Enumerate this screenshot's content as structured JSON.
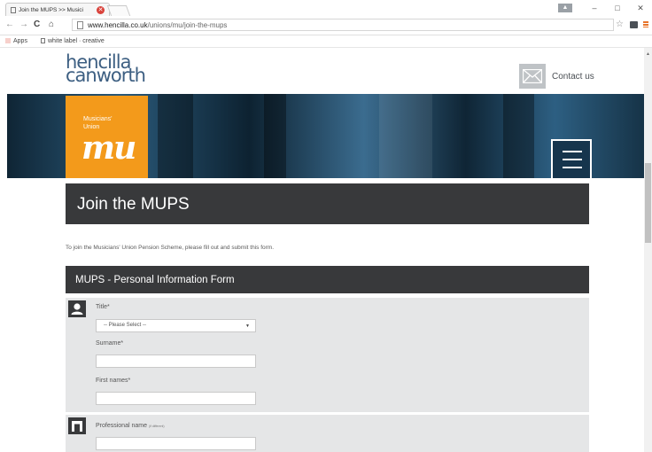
{
  "browser": {
    "tab_title": "Join the MUPS >> Musici",
    "tab_close": "✕",
    "window_user": "▲",
    "minimize": "–",
    "maximize": "□",
    "close": "✕",
    "url_host": "www.hencilla.co.uk",
    "url_path": "/unions/mu/join-the-mups",
    "bookmarks": {
      "apps": "Apps",
      "white_label": "white label · creative"
    }
  },
  "header": {
    "logo_line1": "hencilla",
    "logo_line2": "canworth",
    "contact_label": "Contact us"
  },
  "hero": {
    "badge_line1": "Musicians'",
    "badge_line2": "Union",
    "badge_mark": "mu"
  },
  "page": {
    "title": "Join the MUPS",
    "intro": "To join the Musicians' Union Pension Scheme, please fill out and submit this form.",
    "form_title": "MUPS - Personal Information Form"
  },
  "form": {
    "title_label": "Title*",
    "title_selected": "-- Please Select --",
    "surname_label": "Surname*",
    "surname_value": "",
    "first_names_label": "First names*",
    "first_names_value": "",
    "professional_name_label": "Professional name",
    "professional_name_note": "(if different)",
    "professional_name_value": ""
  },
  "colors": {
    "brand_blue": "#3d5f82",
    "mu_orange": "#f39a1b",
    "dark_bar": "#38393b",
    "section_bg": "#e5e6e7"
  }
}
